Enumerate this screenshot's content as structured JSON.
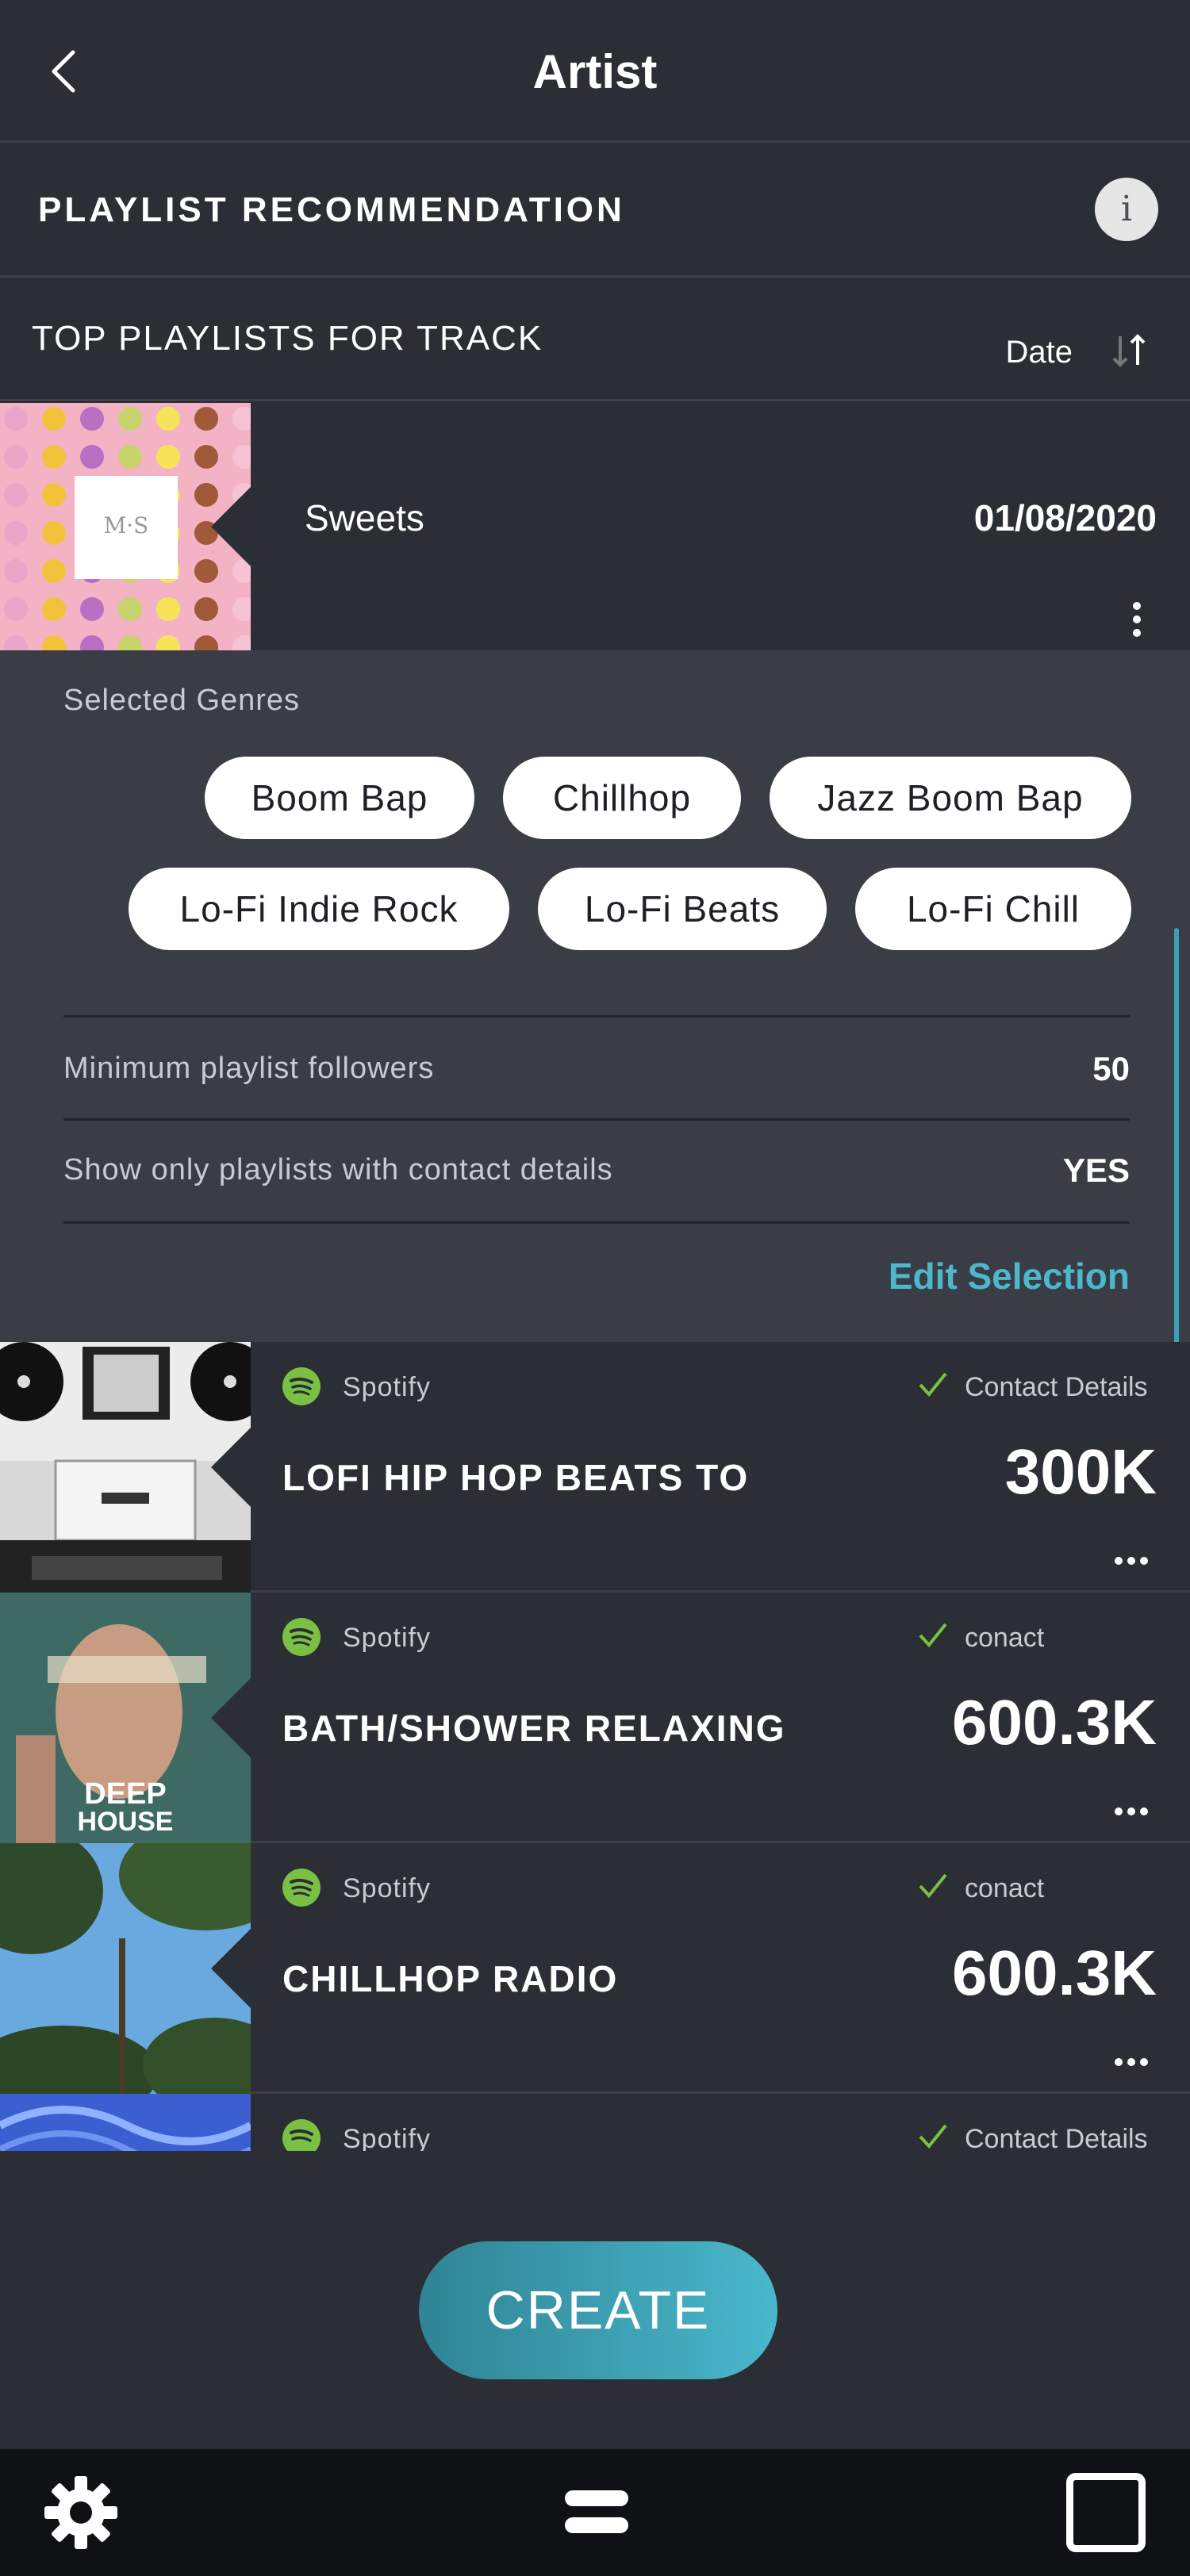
{
  "header": {
    "title": "Artist"
  },
  "recommendation": {
    "title": "PLAYLIST RECOMMENDATION",
    "info_label": "i"
  },
  "top_playlists": {
    "title": "TOP PLAYLISTS FOR TRACK",
    "sort_label": "Date"
  },
  "selected_playlist": {
    "name": "Sweets",
    "date": "01/08/2020"
  },
  "filters": {
    "genres_label": "Selected Genres",
    "genres": [
      "Boom Bap",
      "Chillhop",
      "Jazz Boom Bap",
      "Lo-Fi Indie Rock",
      "Lo-Fi Beats",
      "Lo-Fi Chill"
    ],
    "min_followers_label": "Minimum playlist followers",
    "min_followers_value": "50",
    "contact_only_label": "Show only playlists with contact details",
    "contact_only_value": "YES",
    "edit_label": "Edit Selection"
  },
  "playlists": [
    {
      "source": "Spotify",
      "contact": "Contact Details",
      "name": "LOFI HIP HOP BEATS TO",
      "followers": "300K"
    },
    {
      "source": "Spotify",
      "contact": "conact",
      "name": "BATH/SHOWER RELAXING",
      "followers": "600.3K"
    },
    {
      "source": "Spotify",
      "contact": "conact",
      "name": "CHILLHOP RADIO",
      "followers": "600.3K"
    },
    {
      "source": "Spotify",
      "contact": "Contact Details",
      "name": "",
      "followers": ""
    }
  ],
  "create_label": "CREATE",
  "colors": {
    "accent": "#4cb8cc",
    "spotify": "#7ac143",
    "background": "#2b2e34",
    "panel": "#3a3d45"
  },
  "icons": {
    "back": "back-chevron-icon",
    "info": "info-icon",
    "sort": "sort-arrows-icon",
    "more": "more-vertical-icon",
    "spotify": "spotify-icon",
    "check": "check-icon",
    "ellipsis": "more-horizontal-icon",
    "settings": "gear-icon",
    "menu": "menu-icon",
    "square": "square-icon"
  }
}
